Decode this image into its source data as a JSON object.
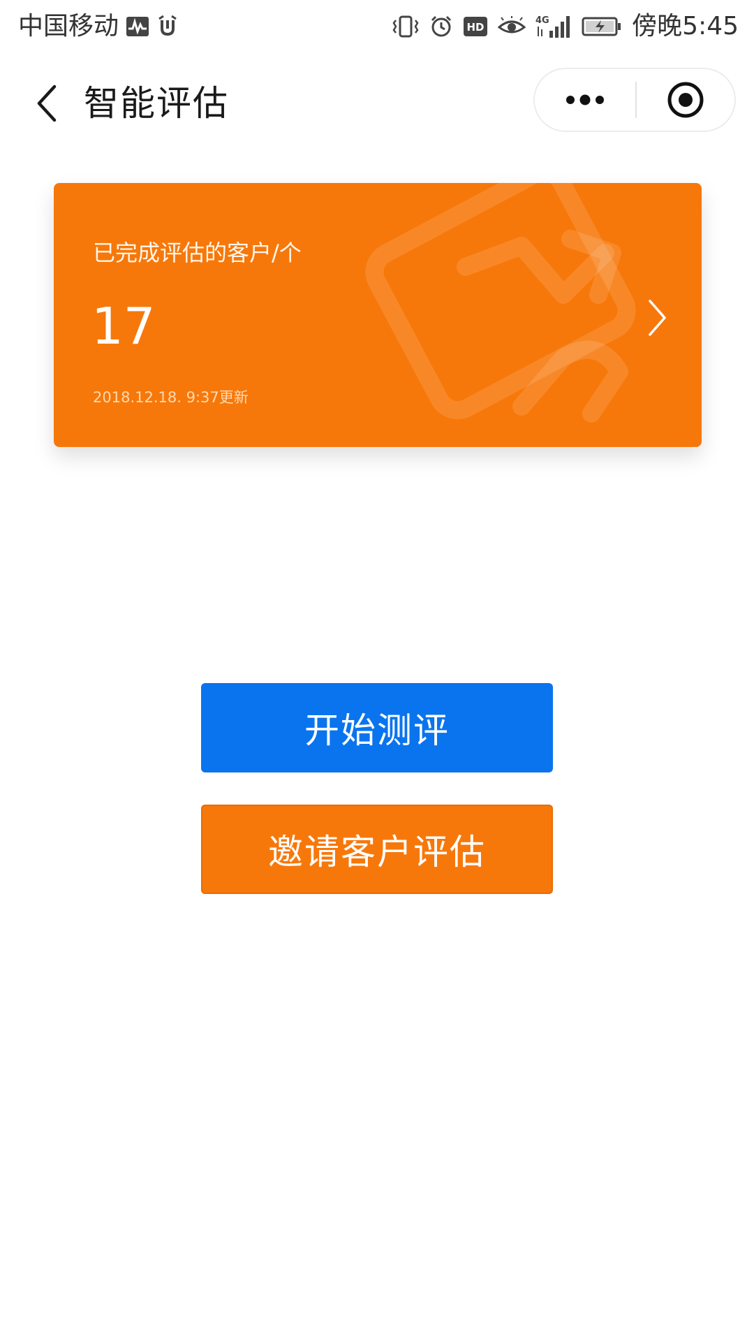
{
  "status_bar": {
    "carrier": "中国移动",
    "network_label": "4G",
    "hd_label": "HD",
    "time": "傍晚5:45",
    "icons": [
      "activity-icon",
      "notification-icon",
      "vibrate-icon",
      "alarm-icon",
      "hd-icon",
      "eye-icon",
      "signal-icon",
      "battery-charging-icon"
    ]
  },
  "nav": {
    "title": "智能评估",
    "back_icon": "chevron-left-icon",
    "more_icon": "more-dots-icon",
    "close_icon": "target-icon"
  },
  "card": {
    "label": "已完成评估的客户/个",
    "value": "17",
    "updated": "2018.12.18. 9:37更新",
    "chevron_icon": "chevron-right-icon",
    "background_color": "#f7780a"
  },
  "buttons": {
    "start_label": "开始测评",
    "start_color": "#0a74ee",
    "invite_label": "邀请客户评估",
    "invite_color": "#f7780a"
  }
}
